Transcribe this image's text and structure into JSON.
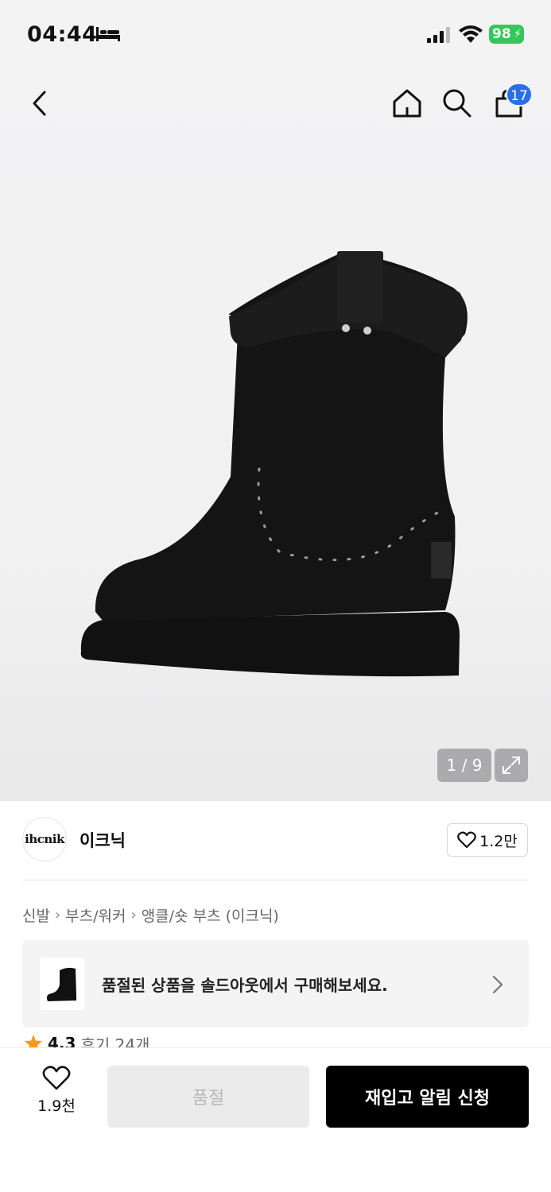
{
  "status_bar": {
    "time": "04:44",
    "battery": "98"
  },
  "nav": {
    "cart_count": "17"
  },
  "gallery": {
    "counter": "1 / 9"
  },
  "brand": {
    "logo_text": "ihcnik",
    "name": "이크닉",
    "likes": "1.2만"
  },
  "breadcrumb": [
    "신발",
    "부츠/워커",
    "앵클/숏 부츠 (이크닉)"
  ],
  "soldout_banner": {
    "text": "품절된 상품을 솔드아웃에서 구매해보세요."
  },
  "rating": {
    "score": "4.3",
    "reviews": "후기 24개"
  },
  "bottom_bar": {
    "wish_count": "1.9천",
    "soldout_label": "품절",
    "restock_label": "재입고 알림 신청"
  },
  "colors": {
    "accent_blue": "#2a6ee8",
    "battery_green": "#35c759",
    "star_orange": "#f59a1a"
  },
  "icons": [
    "bed-icon",
    "signal-icon",
    "wifi-icon",
    "back-icon",
    "home-icon",
    "search-icon",
    "cart-icon",
    "expand-icon",
    "heart-icon",
    "chevron-right-icon",
    "star-icon"
  ]
}
